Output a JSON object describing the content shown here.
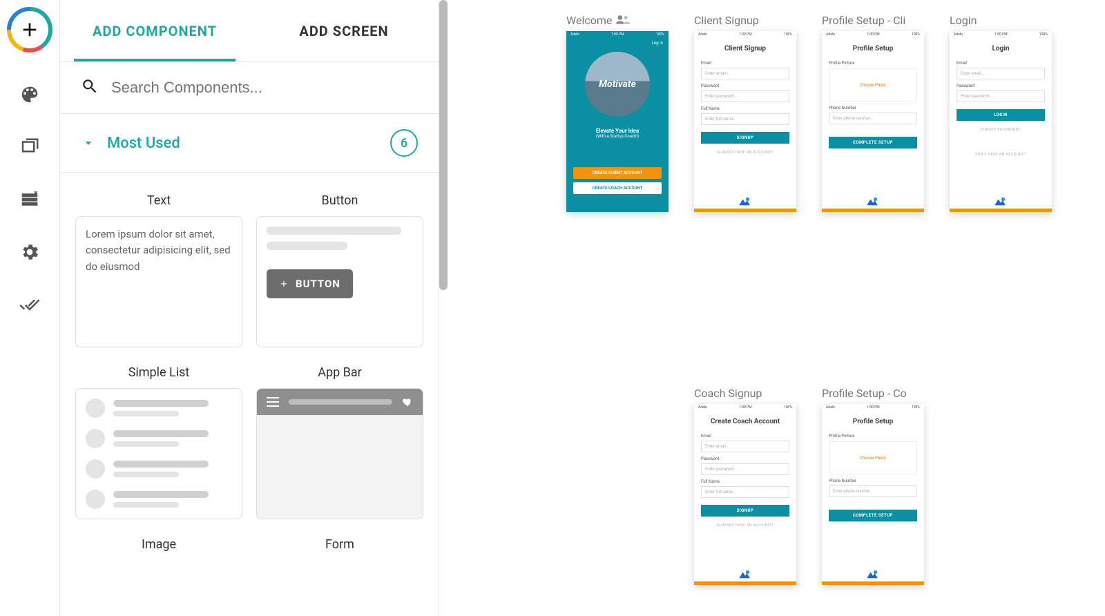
{
  "tabs": {
    "add_component": "ADD COMPONENT",
    "add_screen": "ADD SCREEN"
  },
  "search": {
    "placeholder": "Search Components..."
  },
  "section": {
    "title": "Most Used",
    "count": "6"
  },
  "components": {
    "text": {
      "label": "Text",
      "sample": "Lorem ipsum dolor sit amet, consectetur adipisicing elit, sed do eiusmod"
    },
    "button": {
      "label": "Button",
      "btn_text": "BUTTON"
    },
    "simple_list": {
      "label": "Simple List"
    },
    "app_bar": {
      "label": "App Bar"
    },
    "image": {
      "label": "Image"
    },
    "form": {
      "label": "Form"
    }
  },
  "status": {
    "carrier": "Adalo",
    "time": "1:00 PM",
    "battery": "100%"
  },
  "screens": {
    "welcome": {
      "title": "Welcome",
      "login": "Log In",
      "brand": "Motivate",
      "tagline": "Elevate Your Idea",
      "subtag": "(With a Startup Coach!)",
      "btn_client": "CREATE CLIENT ACCOUNT",
      "btn_coach": "CREATE COACH ACCOUNT"
    },
    "client_signup": {
      "title": "Client Signup",
      "heading": "Client Signup",
      "email": "Email",
      "email_ph": "Enter email...",
      "password": "Password",
      "password_ph": "Enter password...",
      "fullname": "Full Name",
      "fullname_ph": "Enter full name...",
      "submit": "SIGNUP",
      "already": "ALREADY HAVE AN ACCOUNT?"
    },
    "profile_cli": {
      "title": "Profile Setup - Cli",
      "heading": "Profile Setup",
      "pic_label": "Profile Picture",
      "choose": "Choose Photo",
      "phone": "Phone Number",
      "phone_ph": "Enter phone number...",
      "submit": "COMPLETE SETUP"
    },
    "login": {
      "title": "Login",
      "heading": "Login",
      "email": "Email",
      "email_ph": "Enter email...",
      "password": "Password",
      "password_ph": "Enter password...",
      "submit": "LOGIN",
      "forgot": "FORGOT PASSWORD?",
      "noacct": "DON'T HAVE AN ACCOUNT?"
    },
    "coach_signup": {
      "title": "Coach Signup",
      "heading": "Create Coach Account",
      "email": "Email",
      "email_ph": "Enter email...",
      "password": "Password",
      "password_ph": "Enter password...",
      "fullname": "Full Name",
      "fullname_ph": "Enter full name...",
      "submit": "SIGNUP",
      "already": "ALREADY HAVE AN ACCOUNT?"
    },
    "profile_co": {
      "title": "Profile Setup - Co",
      "heading": "Profile Setup",
      "pic_label": "Profile Picture",
      "choose": "Choose Photo",
      "phone": "Phone Number",
      "phone_ph": "Enter phone number...",
      "submit": "COMPLETE SETUP"
    }
  }
}
